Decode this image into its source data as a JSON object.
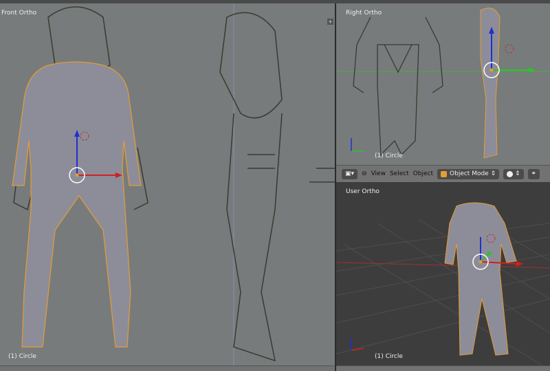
{
  "viewports": [
    {
      "label": "Front Ortho",
      "visible_label": "rtho",
      "object": "(1) Circle"
    },
    {
      "label": "Right Ortho",
      "object": "(1) Circle"
    },
    {
      "label": "User Ortho",
      "object": "(1) Circle"
    }
  ],
  "header": {
    "view": "View",
    "select": "Select",
    "object": "Object",
    "mode": "Object Mode"
  },
  "colors": {
    "viewport_bg": "#777b7b",
    "mesh": "#8c8d99",
    "selection": "#e79c34"
  }
}
